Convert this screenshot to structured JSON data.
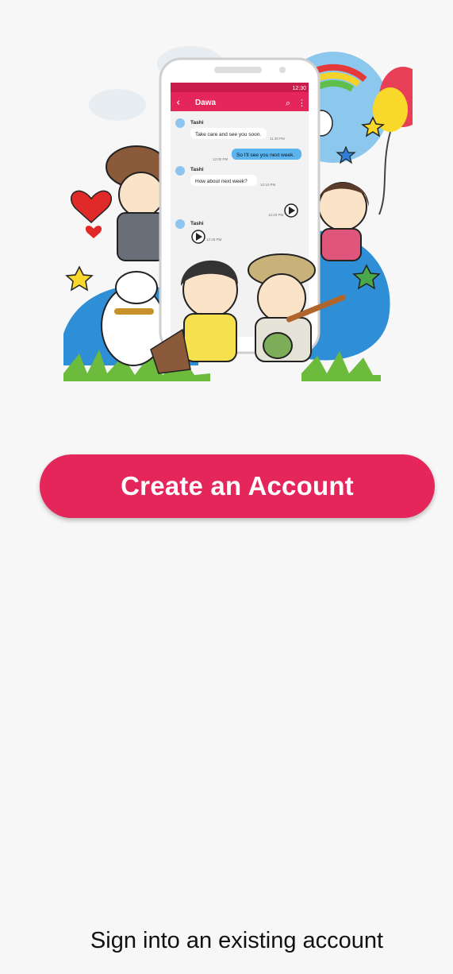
{
  "hero": {
    "phone": {
      "status_time": "12:30",
      "header_title": "Dawa",
      "messages": [
        {
          "sender": "Tashi",
          "text": "Take care and see you soon.",
          "time": "11:30 PM"
        },
        {
          "sender": "",
          "text": "So I'll see you next week.",
          "time": "12:00 PM"
        },
        {
          "sender": "Tashi",
          "text": "How about next week?",
          "time": "12:10 PM"
        },
        {
          "sender": "",
          "text": "",
          "time": "12:20 PM"
        },
        {
          "sender": "Tashi",
          "text": "",
          "time": "12:28 PM"
        }
      ]
    }
  },
  "actions": {
    "create_account_label": "Create an Account",
    "sign_in_label": "Sign into an existing account"
  },
  "colors": {
    "primary": "#e4265a",
    "background": "#f7f7f8"
  }
}
